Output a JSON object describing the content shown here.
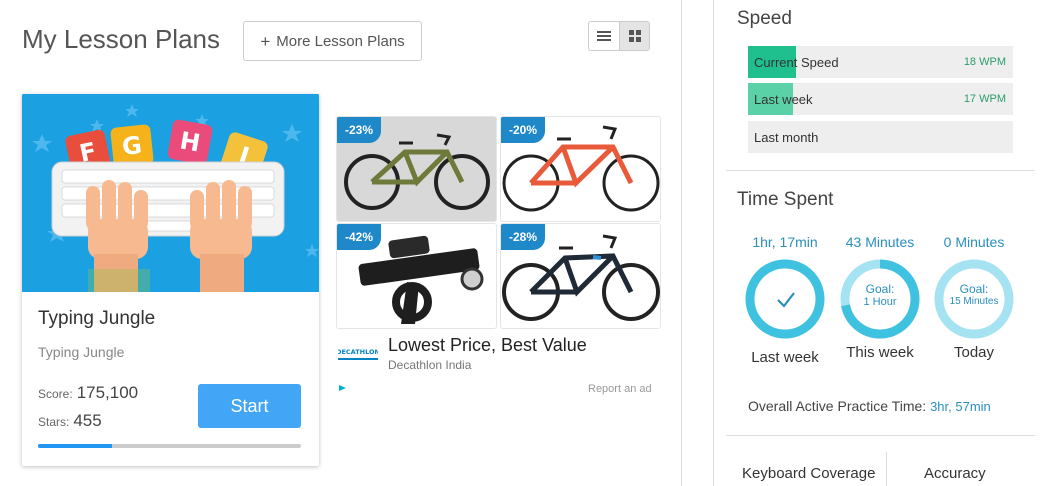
{
  "header": {
    "title": "My Lesson Plans",
    "more_button": "More Lesson Plans"
  },
  "view_toggle": {
    "options": [
      "list",
      "grid"
    ],
    "active": "grid"
  },
  "lesson_card": {
    "name": "Typing Jungle",
    "subtitle": "Typing Jungle",
    "score_label": "Score:",
    "score_value": "175,100",
    "stars_label": "Stars:",
    "stars_value": "455",
    "start_label": "Start",
    "progress_fraction": 0.28,
    "tiles": [
      "F",
      "G",
      "H",
      "J"
    ]
  },
  "ad": {
    "tiles": [
      {
        "discount": "-23%"
      },
      {
        "discount": "-20%"
      },
      {
        "discount": "-42%"
      },
      {
        "discount": "-28%"
      }
    ],
    "logo_text": "DECATHLON",
    "headline": "Lowest Price, Best Value",
    "advertiser": "Decathlon India",
    "report": "Report an ad"
  },
  "speed": {
    "title": "Speed",
    "rows": [
      {
        "label": "Current Speed",
        "value": "18 WPM",
        "fraction": 0.18,
        "color": "#1fc08e"
      },
      {
        "label": "Last week",
        "value": "17 WPM",
        "fraction": 0.17,
        "color": "#5ad1a6"
      },
      {
        "label": "Last month",
        "value": "",
        "fraction": 0,
        "color": "#5ad1a6"
      }
    ]
  },
  "time_spent": {
    "title": "Time Spent",
    "columns": [
      {
        "top": "1hr, 17min",
        "bottom": "Last week",
        "ring_goal": "",
        "ring_value": "",
        "done": true
      },
      {
        "top": "43 Minutes",
        "bottom": "This week",
        "ring_goal": "Goal:",
        "ring_value": "1 Hour",
        "done": false,
        "fraction": 0.72
      },
      {
        "top": "0 Minutes",
        "bottom": "Today",
        "ring_goal": "Goal:",
        "ring_value": "15 Minutes",
        "done": false,
        "fraction": 0
      }
    ],
    "overall_label": "Overall Active Practice Time:",
    "overall_value": "3hr, 57min"
  },
  "bottom_tabs": [
    "Keyboard Coverage",
    "Accuracy"
  ],
  "colors": {
    "accent": "#2a8fbd",
    "ring": "#3fc1e0",
    "ring_light": "#a6e3f2",
    "start": "#42a5f5"
  }
}
